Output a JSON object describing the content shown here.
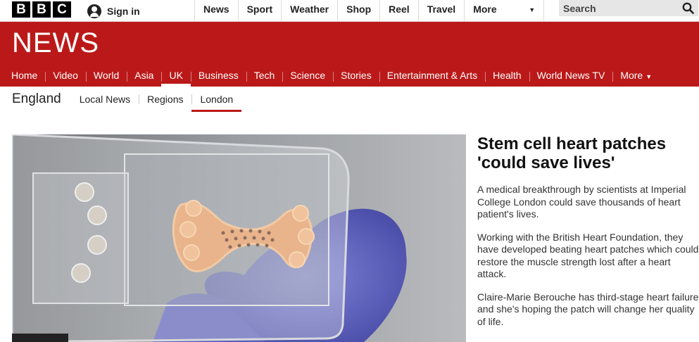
{
  "brand": {
    "bbc_letters": [
      "B",
      "B",
      "C"
    ],
    "news_logo": "NEWS",
    "red": "#bb1919"
  },
  "account": {
    "signin_label": "Sign in",
    "icon": "user-icon"
  },
  "topnav": {
    "items": [
      "News",
      "Sport",
      "Weather",
      "Shop",
      "Reel",
      "Travel"
    ],
    "more_label": "More",
    "more_icon": "caret-down-icon"
  },
  "search": {
    "placeholder": "Search",
    "icon": "search-icon"
  },
  "mainnav": {
    "items": [
      "Home",
      "Video",
      "World",
      "Asia",
      "UK",
      "Business",
      "Tech",
      "Science",
      "Stories",
      "Entertainment & Arts",
      "Health",
      "World News TV"
    ],
    "active": "UK",
    "more_label": "More"
  },
  "subnav": {
    "section": "England",
    "items": [
      "Local News",
      "Regions",
      "London"
    ],
    "active": "London"
  },
  "article": {
    "headline": "Stem cell heart patches 'could save lives'",
    "paragraphs": [
      "A medical breakthrough by scientists at Imperial College London could save thousands of heart patient's lives.",
      "Working with the British Heart Foundation, they have developed beating heart patches which could restore the muscle strength lost after a heart attack.",
      "Claire-Marie Berouche has third-stage heart failure and she's hoping the patch will change her quality of life."
    ]
  }
}
